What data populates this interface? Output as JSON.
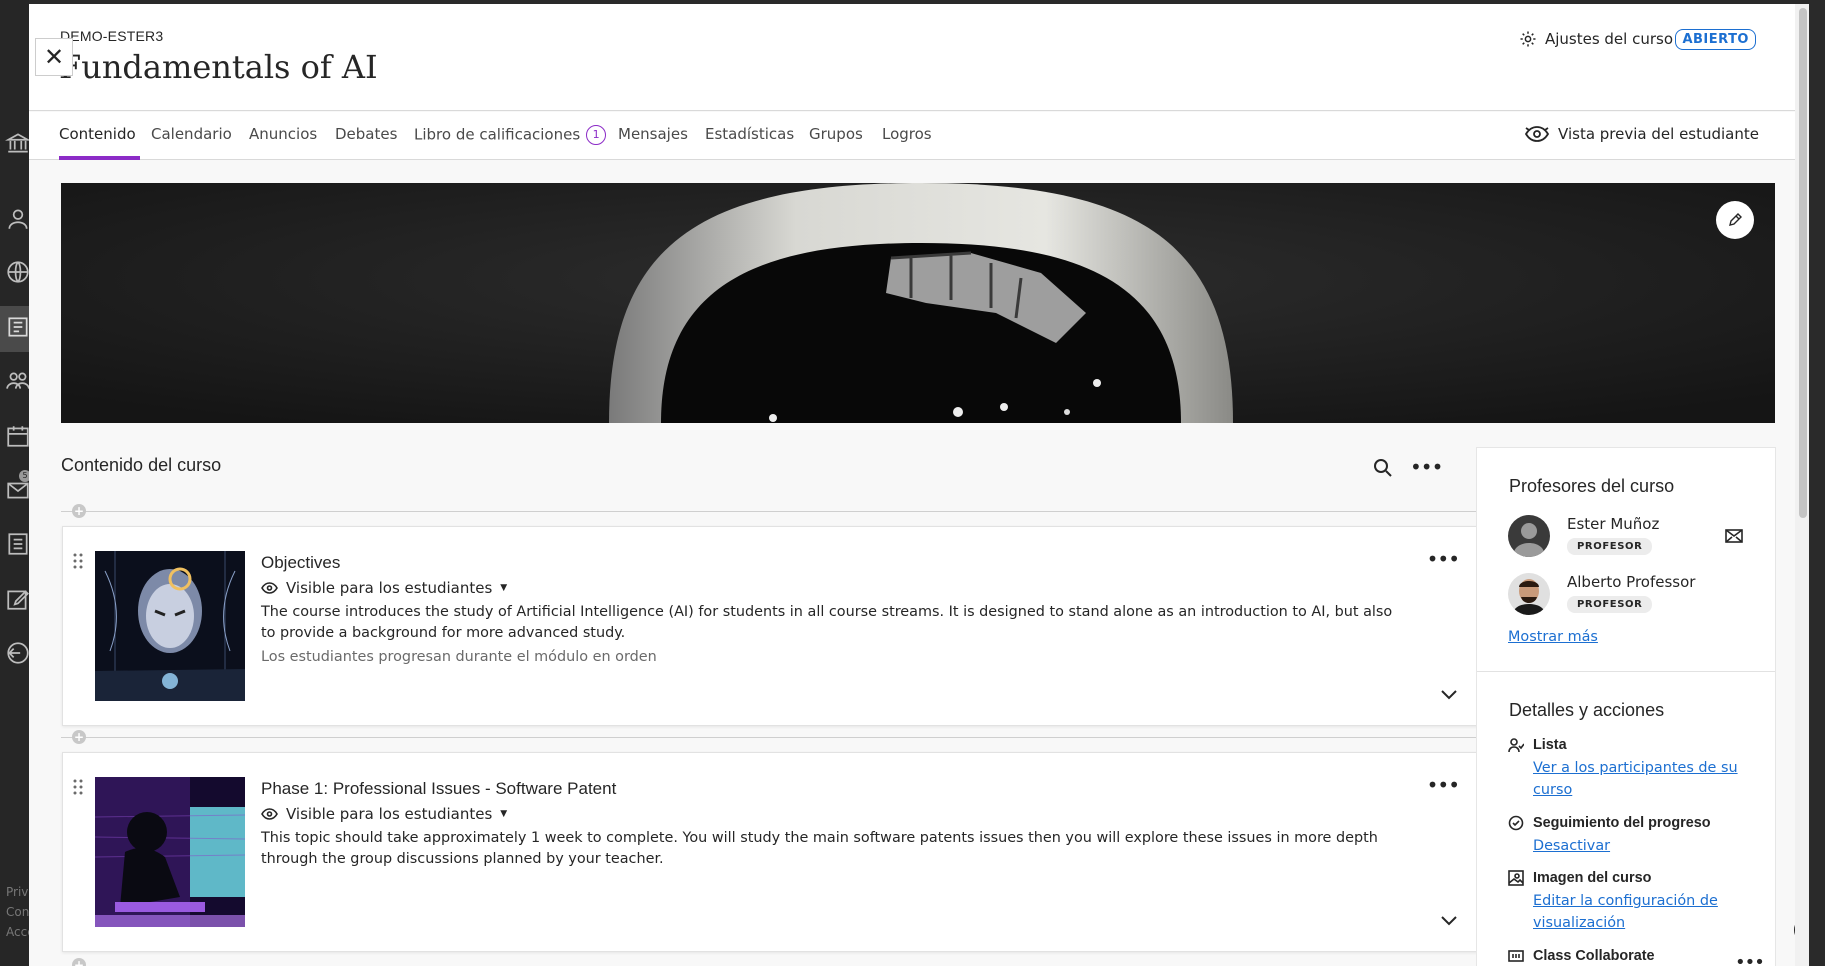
{
  "course": {
    "code": "DEMO-ESTER3",
    "title": "Fundamentals of AI",
    "settings_label": "Ajustes del curso",
    "status": "ABIERTO"
  },
  "tabs": [
    {
      "label": "Contenido",
      "active": true
    },
    {
      "label": "Calendario"
    },
    {
      "label": "Anuncios"
    },
    {
      "label": "Debates"
    },
    {
      "label": "Libro de calificaciones",
      "badge": "1"
    },
    {
      "label": "Mensajes"
    },
    {
      "label": "Estadísticas"
    },
    {
      "label": "Grupos"
    },
    {
      "label": "Logros"
    }
  ],
  "student_preview_label": "Vista previa del estudiante",
  "content": {
    "heading": "Contenido del curso",
    "modules": [
      {
        "title": "Objectives",
        "visibility": "Visible para los estudiantes",
        "description": "The course introduces the study of Artificial Intelligence (AI) for students in all course streams. It is designed to stand alone as an introduction to AI, but also to provide a background for more advanced study.",
        "progress_note": "Los estudiantes progresan durante el módulo en orden"
      },
      {
        "title": "Phase 1: Professional Issues - Software Patent",
        "visibility": "Visible para los estudiantes",
        "description": "This topic should take approximately 1 week to complete. You will study the main software patents issues then you will explore these issues in more depth through the group discussions planned by your teacher."
      }
    ]
  },
  "sidebar": {
    "instructors_heading": "Profesores del curso",
    "instructors": [
      {
        "name": "Ester Muñoz",
        "role": "PROFESOR"
      },
      {
        "name": "Alberto Professor",
        "role": "PROFESOR"
      }
    ],
    "show_more": "Mostrar más",
    "details_heading": "Detalles y acciones",
    "details": [
      {
        "label": "Lista",
        "link": "Ver a los participantes de su curso",
        "icon": "roster-icon"
      },
      {
        "label": "Seguimiento del progreso",
        "link": "Desactivar",
        "icon": "progress-check-icon"
      },
      {
        "label": "Imagen del curso",
        "link": "Editar la configuración de visualización",
        "icon": "image-icon"
      },
      {
        "label": "Class Collaborate",
        "icon": "collaborate-icon"
      }
    ]
  },
  "rail": {
    "footer": [
      "Priva",
      "Con",
      "Acce"
    ],
    "messages_badge": "5"
  },
  "colors": {
    "accent": "#8c2bc7",
    "link": "#1c6fd1"
  }
}
